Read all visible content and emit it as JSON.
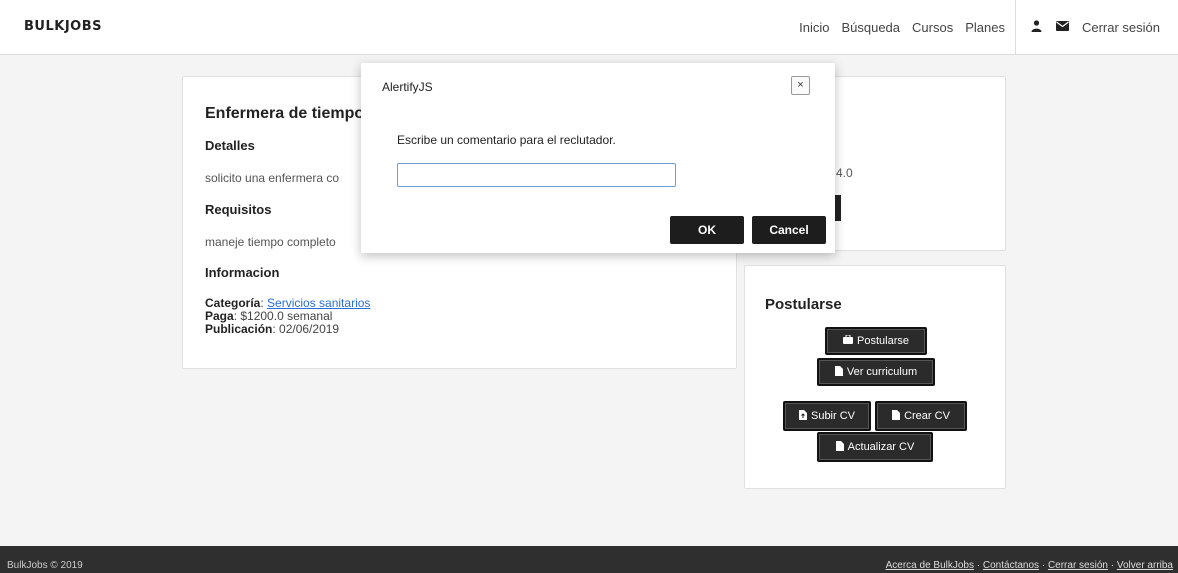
{
  "navbar": {
    "logo": "BULKJOBS",
    "links": [
      "Inicio",
      "Búsqueda",
      "Cursos",
      "Planes"
    ],
    "user_icon": "user-icon",
    "mail_icon": "envelope-icon",
    "logout": "Cerrar sesión"
  },
  "job": {
    "title": "Enfermera de tiempo",
    "details_heading": "Detalles",
    "details_text": "solicito una enfermera co",
    "requirements_heading": "Requisitos",
    "requirements_text": "maneje tiempo completo",
    "info_heading": "Informacion",
    "category_label": "Categoría",
    "category_value": "Servicios sanitarios",
    "pay_label": "Paga",
    "pay_value": "$1200.0 semanal",
    "published_label": "Publicación",
    "published_value": "02/06/2019"
  },
  "right_top": {
    "frag1": ".",
    "frag2": "4.0"
  },
  "apply": {
    "title": "Postularse",
    "postularse": "Postularse",
    "ver_cv": "Ver curriculum",
    "subir_cv": "Subir CV",
    "crear_cv": "Crear CV",
    "actualizar_cv": "Actualizar CV"
  },
  "modal": {
    "title": "AlertifyJS",
    "close": "×",
    "message": "Escribe un comentario para el reclutador.",
    "input_value": "",
    "ok": "OK",
    "cancel": "Cancel"
  },
  "footer": {
    "copyright": "BulkJobs © 2019",
    "links": [
      "Acerca de BulkJobs",
      "Contáctanos",
      "Cerrar sesión",
      "Volver arriba"
    ],
    "separator": " · "
  }
}
